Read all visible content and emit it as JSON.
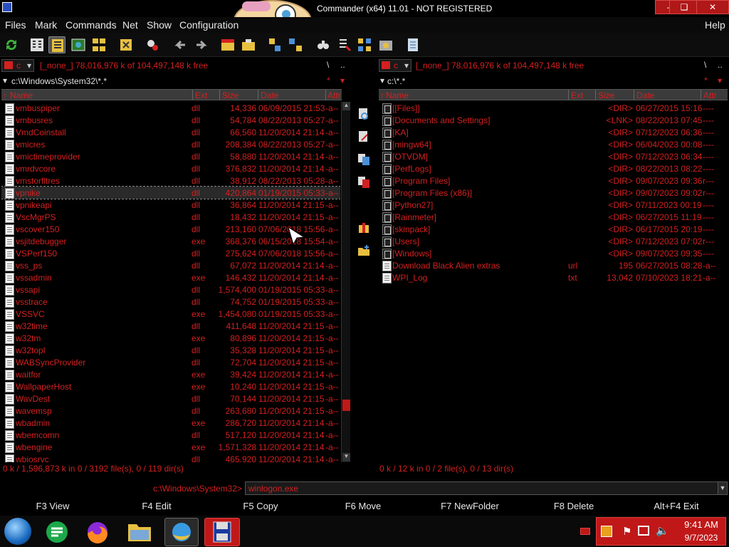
{
  "window": {
    "title": "Commander (x64) 11.01 - NOT REGISTERED"
  },
  "menu": [
    "Files",
    "Mark",
    "Commands",
    "Net",
    "Show",
    "Configuration",
    "Help"
  ],
  "left": {
    "drive": "c",
    "drive_info": "[_none_]  78,016,976 k of 104,497,148 k free",
    "root_btn": "\\",
    "up_btn": "..",
    "path": "c:\\Windows\\System32\\*.*",
    "columns": [
      "Name",
      "Ext",
      "Size",
      "Date",
      "Attr"
    ],
    "rows": [
      {
        "name": "vmbuspiper",
        "ext": "dll",
        "size": "14,336",
        "date": "06/09/2015 21:53",
        "attr": "-a--"
      },
      {
        "name": "vmbusres",
        "ext": "dll",
        "size": "54,784",
        "date": "08/22/2013 05:27",
        "attr": "-a--"
      },
      {
        "name": "VmdCoinstall",
        "ext": "dll",
        "size": "66,560",
        "date": "11/20/2014 21:14",
        "attr": "-a--"
      },
      {
        "name": "vmicres",
        "ext": "dll",
        "size": "208,384",
        "date": "08/22/2013 05:27",
        "attr": "-a--"
      },
      {
        "name": "vmictimeprovider",
        "ext": "dll",
        "size": "58,880",
        "date": "11/20/2014 21:14",
        "attr": "-a--"
      },
      {
        "name": "vmrdvcore",
        "ext": "dll",
        "size": "376,832",
        "date": "11/20/2014 21:14",
        "attr": "-a--"
      },
      {
        "name": "vmstorfltres",
        "ext": "dll",
        "size": "38,912",
        "date": "08/22/2013 05:28",
        "attr": "-a--"
      },
      {
        "name": "vpnike",
        "ext": "dll",
        "size": "420,864",
        "date": "01/19/2015 05:33",
        "attr": "-a--"
      },
      {
        "name": "vpnikeapi",
        "ext": "dll",
        "size": "36,864",
        "date": "11/20/2014 21:15",
        "attr": "-a--"
      },
      {
        "name": "VscMgrPS",
        "ext": "dll",
        "size": "18,432",
        "date": "11/20/2014 21:15",
        "attr": "-a--"
      },
      {
        "name": "vscover150",
        "ext": "dll",
        "size": "213,160",
        "date": "07/06/2018 15:56",
        "attr": "-a--"
      },
      {
        "name": "vsjitdebugger",
        "ext": "exe",
        "size": "368,376",
        "date": "06/15/2018 15:54",
        "attr": "-a--"
      },
      {
        "name": "VSPerf150",
        "ext": "dll",
        "size": "275,624",
        "date": "07/06/2018 15:56",
        "attr": "-a--"
      },
      {
        "name": "vss_ps",
        "ext": "dll",
        "size": "67,072",
        "date": "11/20/2014 21:14",
        "attr": "-a--"
      },
      {
        "name": "vssadmin",
        "ext": "exe",
        "size": "146,432",
        "date": "11/20/2014 21:14",
        "attr": "-a--"
      },
      {
        "name": "vssapi",
        "ext": "dll",
        "size": "1,574,400",
        "date": "01/19/2015 05:33",
        "attr": "-a--"
      },
      {
        "name": "vsstrace",
        "ext": "dll",
        "size": "74,752",
        "date": "01/19/2015 05:33",
        "attr": "-a--"
      },
      {
        "name": "VSSVC",
        "ext": "exe",
        "size": "1,454,080",
        "date": "01/19/2015 05:33",
        "attr": "-a--"
      },
      {
        "name": "w32time",
        "ext": "dll",
        "size": "411,648",
        "date": "11/20/2014 21:15",
        "attr": "-a--"
      },
      {
        "name": "w32tm",
        "ext": "exe",
        "size": "80,896",
        "date": "11/20/2014 21:15",
        "attr": "-a--"
      },
      {
        "name": "w32topl",
        "ext": "dll",
        "size": "35,328",
        "date": "11/20/2014 21:15",
        "attr": "-a--"
      },
      {
        "name": "WABSyncProvider",
        "ext": "dll",
        "size": "72,704",
        "date": "11/20/2014 21:15",
        "attr": "-a--"
      },
      {
        "name": "waitfor",
        "ext": "exe",
        "size": "39,424",
        "date": "11/20/2014 21:14",
        "attr": "-a--"
      },
      {
        "name": "WallpaperHost",
        "ext": "exe",
        "size": "10,240",
        "date": "11/20/2014 21:15",
        "attr": "-a--"
      },
      {
        "name": "WavDest",
        "ext": "dll",
        "size": "70,144",
        "date": "11/20/2014 21:15",
        "attr": "-a--"
      },
      {
        "name": "wavemsp",
        "ext": "dll",
        "size": "263,680",
        "date": "11/20/2014 21:15",
        "attr": "-a--"
      },
      {
        "name": "wbadmin",
        "ext": "exe",
        "size": "286,720",
        "date": "11/20/2014 21:14",
        "attr": "-a--"
      },
      {
        "name": "wbemcomn",
        "ext": "dll",
        "size": "517,120",
        "date": "11/20/2014 21:14",
        "attr": "-a--"
      },
      {
        "name": "wbengine",
        "ext": "exe",
        "size": "1,571,328",
        "date": "11/20/2014 21:14",
        "attr": "-a--"
      },
      {
        "name": "wbiosrvc",
        "ext": "dll",
        "size": "465,920",
        "date": "11/20/2014 21:14",
        "attr": "-a--"
      }
    ],
    "status": "0 k / 1,596,873 k in 0 / 3192 file(s), 0 / 119 dir(s)"
  },
  "right": {
    "drive": "c",
    "drive_info": "[_none_]  78,016,976 k of 104,497,148 k free",
    "root_btn": "\\",
    "up_btn": "..",
    "path": "c:\\*.*",
    "columns": [
      "Name",
      "Ext",
      "Size",
      "Date",
      "Attr"
    ],
    "rows": [
      {
        "name": "[[Files]]",
        "ext": "",
        "size": "<DIR>",
        "date": "06/27/2015 15:16",
        "attr": "----"
      },
      {
        "name": "[Documents and Settings]",
        "ext": "",
        "size": "<LNK>",
        "date": "08/22/2013 07:45",
        "attr": "----"
      },
      {
        "name": "[KA]",
        "ext": "",
        "size": "<DIR>",
        "date": "07/12/2023 06:36",
        "attr": "----"
      },
      {
        "name": "[mingw64]",
        "ext": "",
        "size": "<DIR>",
        "date": "06/04/2023 00:08",
        "attr": "----"
      },
      {
        "name": "[OTVDM]",
        "ext": "",
        "size": "<DIR>",
        "date": "07/12/2023 06:34",
        "attr": "----"
      },
      {
        "name": "[PerfLogs]",
        "ext": "",
        "size": "<DIR>",
        "date": "08/22/2013 08:22",
        "attr": "----"
      },
      {
        "name": "[Program Files]",
        "ext": "",
        "size": "<DIR>",
        "date": "09/07/2023 09:36",
        "attr": "r---"
      },
      {
        "name": "[Program Files (x86)]",
        "ext": "",
        "size": "<DIR>",
        "date": "09/07/2023 09:02",
        "attr": "r---"
      },
      {
        "name": "[Python27]",
        "ext": "",
        "size": "<DIR>",
        "date": "07/11/2023 00:19",
        "attr": "----"
      },
      {
        "name": "[Rainmeter]",
        "ext": "",
        "size": "<DIR>",
        "date": "06/27/2015 11:19",
        "attr": "----"
      },
      {
        "name": "[skinpack]",
        "ext": "",
        "size": "<DIR>",
        "date": "06/17/2015 20:19",
        "attr": "----"
      },
      {
        "name": "[Users]",
        "ext": "",
        "size": "<DIR>",
        "date": "07/12/2023 07:02",
        "attr": "r---"
      },
      {
        "name": "[Windows]",
        "ext": "",
        "size": "<DIR>",
        "date": "09/07/2023 09:35",
        "attr": "----"
      },
      {
        "name": "Download Black Alien extras",
        "ext": "url",
        "size": "195",
        "date": "06/27/2015 08:28",
        "attr": "-a--"
      },
      {
        "name": "WPI_Log",
        "ext": "txt",
        "size": "13,042",
        "date": "07/10/2023 18:21",
        "attr": "-a--"
      }
    ],
    "status": "0 k / 12 k in 0 / 2 file(s), 0 / 13 dir(s)"
  },
  "cmdline": {
    "path": "c:\\Windows\\System32>",
    "value": "winlogon.exe"
  },
  "fkeys": [
    "F3 View",
    "F4 Edit",
    "F5 Copy",
    "F6 Move",
    "F7 NewFolder",
    "F8 Delete",
    "Alt+F4 Exit"
  ],
  "clock": {
    "time": "9:41 AM",
    "date": "9/7/2023"
  },
  "colors": {
    "accent": "#d42020",
    "background": "#000000"
  }
}
